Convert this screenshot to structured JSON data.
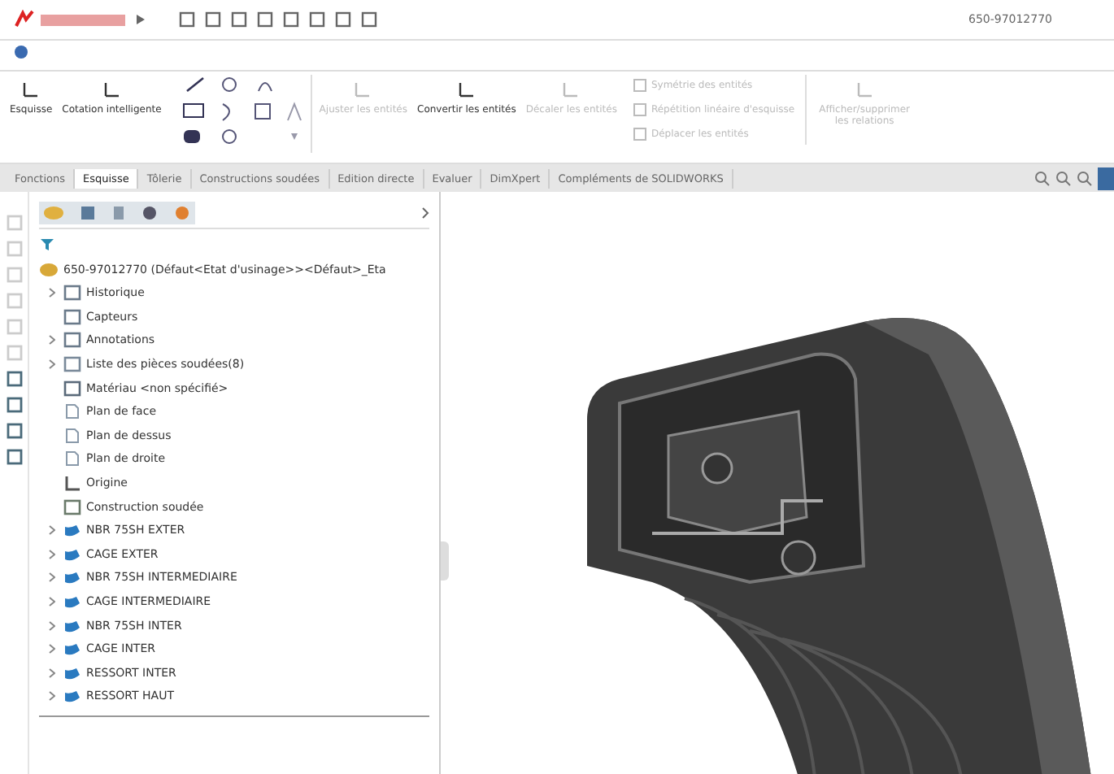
{
  "window": {
    "title": "650-97012770"
  },
  "commands": [
    {
      "label": "Esquisse",
      "disabled": false,
      "kind": "big"
    },
    {
      "label": "Cotation intelligente",
      "disabled": false,
      "kind": "big"
    },
    {
      "label": "Ajuster les entités",
      "disabled": true,
      "kind": "big"
    },
    {
      "label": "Convertir les entités",
      "disabled": false,
      "kind": "big"
    },
    {
      "label": "Décaler les entités",
      "disabled": true,
      "kind": "big"
    },
    {
      "label": "Symétrie des entités",
      "disabled": true,
      "kind": "small"
    },
    {
      "label": "Répétition linéaire d'esquisse",
      "disabled": true,
      "kind": "small"
    },
    {
      "label": "Déplacer les entités",
      "disabled": true,
      "kind": "small"
    },
    {
      "label": "Afficher/supprimer les relations",
      "disabled": true,
      "kind": "big"
    }
  ],
  "tabs": [
    {
      "label": "Fonctions",
      "selected": false
    },
    {
      "label": "Esquisse",
      "selected": true
    },
    {
      "label": "Tôlerie",
      "selected": false
    },
    {
      "label": "Constructions soudées",
      "selected": false
    },
    {
      "label": "Edition directe",
      "selected": false
    },
    {
      "label": "Evaluer",
      "selected": false
    },
    {
      "label": "DimXpert",
      "selected": false
    },
    {
      "label": "Compléments de SOLIDWORKS",
      "selected": false
    }
  ],
  "tree": {
    "root": "650-97012770  (Défaut<Etat d'usinage>><Défaut>_Eta",
    "items": [
      {
        "label": "Historique",
        "expandable": true,
        "kind": "folder"
      },
      {
        "label": "Capteurs",
        "expandable": false,
        "kind": "folder"
      },
      {
        "label": "Annotations",
        "expandable": true,
        "kind": "folder"
      },
      {
        "label": "Liste des pièces soudées(8)",
        "expandable": true,
        "kind": "list"
      },
      {
        "label": "Matériau <non spécifié>",
        "expandable": false,
        "kind": "material"
      },
      {
        "label": "Plan de face",
        "expandable": false,
        "kind": "plane"
      },
      {
        "label": "Plan de dessus",
        "expandable": false,
        "kind": "plane"
      },
      {
        "label": "Plan de droite",
        "expandable": false,
        "kind": "plane"
      },
      {
        "label": "Origine",
        "expandable": false,
        "kind": "origin"
      },
      {
        "label": "Construction soudée",
        "expandable": false,
        "kind": "weld"
      },
      {
        "label": "NBR 75SH EXTER",
        "expandable": true,
        "kind": "body"
      },
      {
        "label": "CAGE EXTER",
        "expandable": true,
        "kind": "body"
      },
      {
        "label": "NBR 75SH INTERMEDIAIRE",
        "expandable": true,
        "kind": "body"
      },
      {
        "label": "CAGE INTERMEDIAIRE",
        "expandable": true,
        "kind": "body"
      },
      {
        "label": "NBR 75SH INTER",
        "expandable": true,
        "kind": "body"
      },
      {
        "label": "CAGE INTER",
        "expandable": true,
        "kind": "body"
      },
      {
        "label": "RESSORT INTER",
        "expandable": true,
        "kind": "body"
      },
      {
        "label": "RESSORT HAUT",
        "expandable": true,
        "kind": "body"
      }
    ]
  }
}
